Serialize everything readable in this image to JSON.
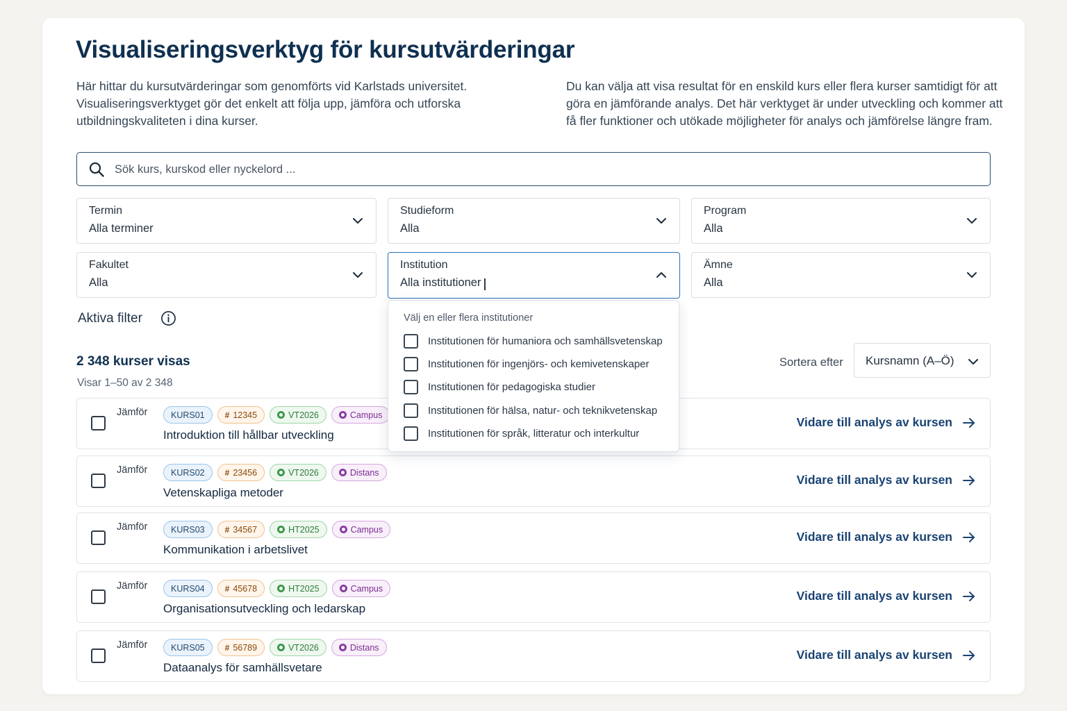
{
  "title": "Visualiseringsverktyg för kursutvärderingar",
  "intro_left": "Här hittar du kursutvärderingar som genomförts vid Karlstads universitet. Visualiseringsverktyget gör det enkelt att följa upp, jämföra och utforska utbildningskvaliteten i dina kurser.",
  "intro_right": "Du kan välja att visa resultat för en enskild kurs eller flera kurser samtidigt för att göra en jämförande analys. Det här verktyget är under utveckling och kommer att få fler funktioner och utökade möjligheter för analys och jämförelse längre fram.",
  "search": {
    "placeholder": "Sök kurs, kurskod eller nyckelord ..."
  },
  "filters": {
    "termin": {
      "label": "Termin",
      "value": "Alla terminer"
    },
    "studieform": {
      "label": "Studieform",
      "value": "Alla"
    },
    "program": {
      "label": "Program",
      "value": "Alla"
    },
    "fakultet": {
      "label": "Fakultet",
      "value": "Alla"
    },
    "institution": {
      "label": "Institution",
      "value": "Alla institutioner"
    },
    "amne": {
      "label": "Ämne",
      "value": "Alla"
    }
  },
  "active_filters_label": "Aktiva filter",
  "institution_menu": {
    "hint": "Välj en eller flera institutioner",
    "options": [
      "Institutionen för humaniora och samhällsvetenskap",
      "Institutionen för ingenjörs- och kemivetenskaper",
      "Institutionen för pedagogiska studier",
      "Institutionen för hälsa, natur- och teknikvetenskap",
      "Institutionen för språk, litteratur och interkultur"
    ]
  },
  "results": {
    "count": "2 348 kurser visas",
    "showing": "Visar 1–50 av 2 348"
  },
  "sort": {
    "label": "Sortera efter",
    "value": "Kursnamn (A–Ö)"
  },
  "compare_label": "Jämför",
  "link_label": "Vidare till analys av kursen",
  "courses": [
    {
      "code": "KURS01",
      "number": "12345",
      "term": "VT2026",
      "mode": "Campus",
      "title": "Introduktion till hållbar utveckling"
    },
    {
      "code": "KURS02",
      "number": "23456",
      "term": "VT2026",
      "mode": "Distans",
      "title": "Vetenskapliga metoder"
    },
    {
      "code": "KURS03",
      "number": "34567",
      "term": "HT2025",
      "mode": "Campus",
      "title": "Kommunikation i arbetslivet"
    },
    {
      "code": "KURS04",
      "number": "45678",
      "term": "HT2025",
      "mode": "Campus",
      "title": "Organisationsutveckling och ledarskap"
    },
    {
      "code": "KURS05",
      "number": "56789",
      "term": "VT2026",
      "mode": "Distans",
      "title": "Dataanalys för samhällsvetare"
    }
  ],
  "colors": {
    "heading": "#0f3050",
    "link": "#1a4373",
    "focus": "#2b6fb6"
  }
}
